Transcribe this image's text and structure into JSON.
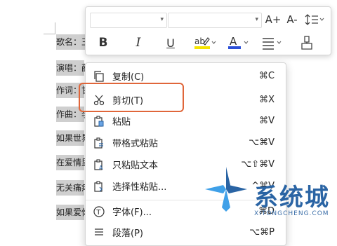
{
  "document": {
    "lines": [
      "歌名：王",
      "演唱：薛",
      "作词：甘",
      "作曲：李",
      "如果世界",
      "在爱情里",
      "无关痛痒",
      "如果爱你"
    ]
  },
  "mini_toolbar": {
    "font_name_value": "",
    "font_size_value": "",
    "grow_font_label": "A+",
    "shrink_font_label": "A-",
    "bold_label": "B",
    "italic_label": "I",
    "underline_label": "U"
  },
  "context_menu": {
    "items": [
      {
        "label": "复制(C)",
        "shortcut": "⌘C"
      },
      {
        "label": "剪切(T)",
        "shortcut": "⌘X"
      },
      {
        "label": "粘贴",
        "shortcut": "⌘V"
      },
      {
        "label": "带格式粘贴",
        "shortcut": "⌥⌘V"
      },
      {
        "label": "只粘贴文本",
        "shortcut": "⌥⇧⌘V"
      },
      {
        "label": "选择性粘贴...",
        "shortcut": "^⌘V"
      },
      {
        "label": "字体(F)...",
        "shortcut": "⌘D"
      },
      {
        "label": "段落(P)",
        "shortcut": "⌥⌘P"
      }
    ]
  },
  "watermark": {
    "brand": "系统城",
    "domain": "XITONGCHENG.COM"
  },
  "colors": {
    "highlight_border": "#e0663a",
    "font_color_bar": "#2b4fd8",
    "highlight_bar": "#f5e400",
    "brand_blue": "#2a64a4"
  }
}
